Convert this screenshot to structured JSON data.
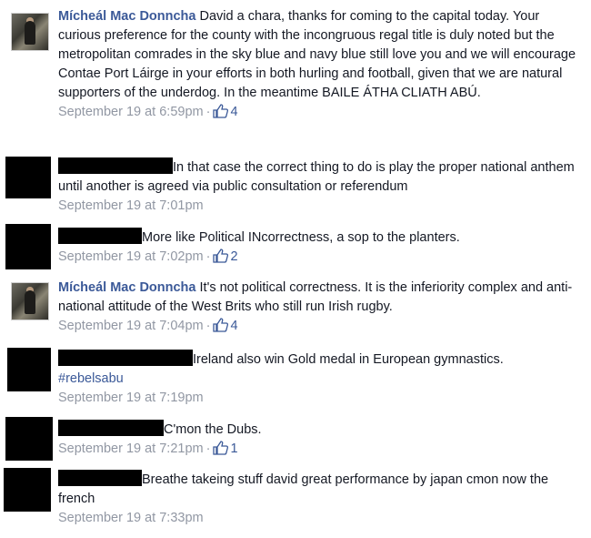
{
  "comments": [
    {
      "author": "Mícheál Mac Donncha",
      "text": "David a chara, thanks for coming to the capital today. Your curious preference for the county with the incongruous regal title is duly noted but the metropolitan comrades in the sky blue and navy blue still love you and we will encourage Contae Port Láirge in your efforts in both hurling and football, given that we are natural supporters of the underdog. In the meantime BAILE ÁTHA CLIATH ABÚ.",
      "time": "September 19 at 6:59pm",
      "likes": "4"
    },
    {
      "text": "In that case the correct thing to do is play the proper national anthem until another is agreed via public consultation or referendum",
      "time": "September 19 at 7:01pm"
    },
    {
      "text": "More like Political INcorrectness, a sop to the planters.",
      "time": "September 19 at 7:02pm",
      "likes": "2"
    },
    {
      "author": "Mícheál Mac Donncha",
      "text": "It's not political correctness. It is the inferiority complex and anti-national attitude of the West Brits who still run Irish rugby.",
      "time": "September 19 at 7:04pm",
      "likes": "4"
    },
    {
      "text": "Ireland also win Gold medal in European gymnastics.",
      "hashtag": "#rebelsabu",
      "time": "September 19 at 7:19pm"
    },
    {
      "text": "C'mon the Dubs.",
      "time": "September 19 at 7:21pm",
      "likes": "1"
    },
    {
      "text": "Breathe takeing stuff david great performance by japan cmon now the french",
      "time": "September 19 at 7:33pm"
    }
  ],
  "meta_separator": "·",
  "colors": {
    "author_link": "#3b5998",
    "meta_text": "#9197a3",
    "body_text": "#141823",
    "redaction": "#000000"
  },
  "icons": {
    "like": "thumbs-up-icon",
    "avatar": "profile-photo"
  }
}
